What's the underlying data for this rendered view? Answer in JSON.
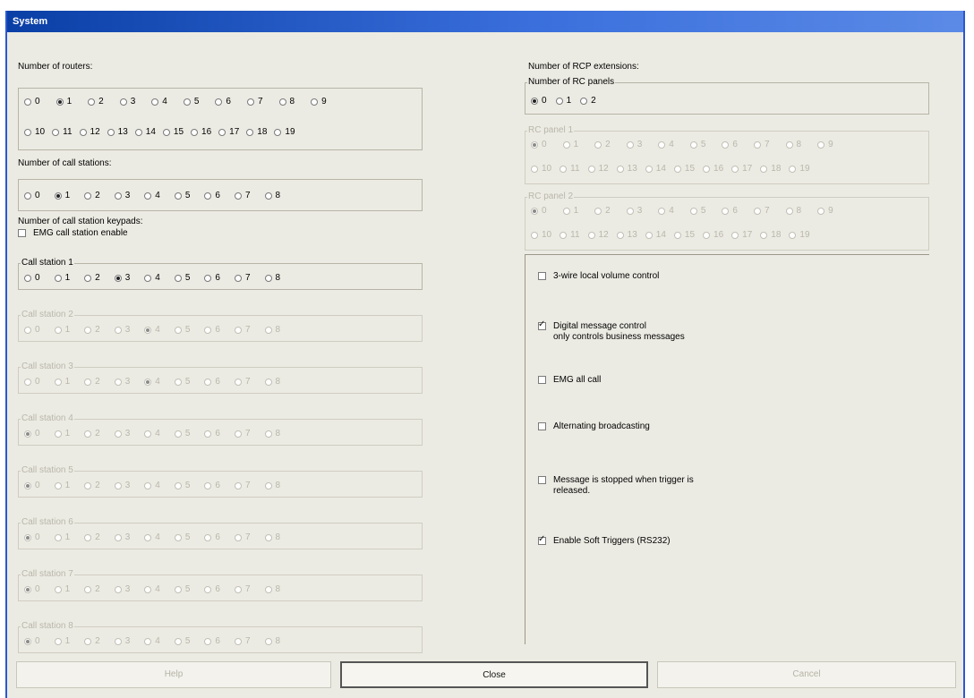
{
  "window": {
    "title": "System"
  },
  "routers": {
    "label": "Number of routers:",
    "row1": [
      "0",
      "1",
      "2",
      "3",
      "4",
      "5",
      "6",
      "7",
      "8",
      "9"
    ],
    "row2": [
      "10",
      "11",
      "12",
      "13",
      "14",
      "15",
      "16",
      "17",
      "18",
      "19"
    ],
    "selected": "1"
  },
  "call_stations": {
    "label": "Number of call stations:",
    "options": [
      "0",
      "1",
      "2",
      "3",
      "4",
      "5",
      "6",
      "7",
      "8"
    ],
    "selected": "1"
  },
  "keypads": {
    "label": "Number of call station keypads:",
    "emg_label": "EMG call station enable",
    "groups": [
      {
        "title": "Call station 1",
        "selected": "3"
      },
      {
        "title": "Call station 2",
        "selected": "4"
      },
      {
        "title": "Call station 3",
        "selected": "4"
      },
      {
        "title": "Call station 4",
        "selected": "0"
      },
      {
        "title": "Call station 5",
        "selected": "0"
      },
      {
        "title": "Call station 6",
        "selected": "0"
      },
      {
        "title": "Call station 7",
        "selected": "0"
      },
      {
        "title": "Call station 8",
        "selected": "0"
      }
    ],
    "options": [
      "0",
      "1",
      "2",
      "3",
      "4",
      "5",
      "6",
      "7",
      "8"
    ]
  },
  "rcp": {
    "label": "Number of RCP extensions:",
    "panels_title": "Number of RC panels",
    "panels_options": [
      "0",
      "1",
      "2"
    ],
    "panels_selected": "0",
    "rc_panels": [
      {
        "title": "RC panel 1",
        "selected": "0"
      },
      {
        "title": "RC panel 2",
        "selected": "0"
      }
    ],
    "rc_row1": [
      "0",
      "1",
      "2",
      "3",
      "4",
      "5",
      "6",
      "7",
      "8",
      "9"
    ],
    "rc_row2": [
      "10",
      "11",
      "12",
      "13",
      "14",
      "15",
      "16",
      "17",
      "18",
      "19"
    ]
  },
  "options": [
    {
      "label": "3-wire local volume control",
      "checked": false
    },
    {
      "label": "Digital message control\nonly controls business messages",
      "checked": true
    },
    {
      "label": "EMG all call",
      "checked": false
    },
    {
      "label": "Alternating broadcasting",
      "checked": false
    },
    {
      "label": "Message is stopped when trigger is\nreleased.",
      "checked": false
    },
    {
      "label": "Enable Soft Triggers (RS232)",
      "checked": true
    }
  ],
  "buttons": {
    "left": "Help",
    "close": "Close",
    "cancel": "Cancel"
  }
}
